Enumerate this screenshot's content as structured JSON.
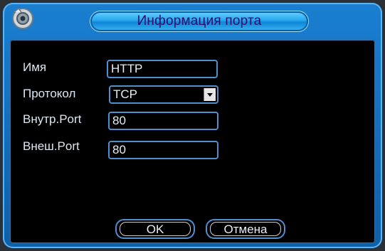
{
  "dialog": {
    "title": "Информация порта"
  },
  "form": {
    "name_label": "Имя",
    "name_value": "HTTP",
    "protocol_label": "Протокол",
    "protocol_value": "TCP",
    "internal_port_label": "Внутр.Port",
    "internal_port_value": "80",
    "external_port_label": "Внеш.Port",
    "external_port_value": "80"
  },
  "buttons": {
    "ok_label": "OK",
    "cancel_label": "Отмена"
  },
  "colors": {
    "accent": "#4e8fd0",
    "title_text": "#2f0d6b",
    "frame": "#1a7fd0"
  }
}
